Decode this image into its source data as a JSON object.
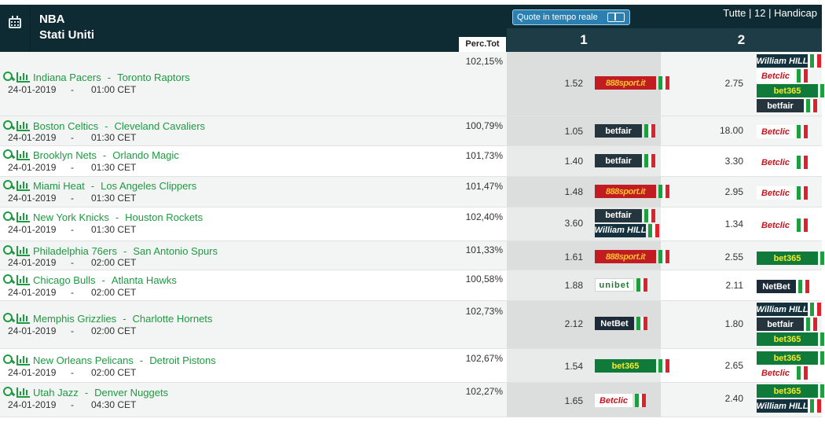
{
  "header": {
    "league": "NBA",
    "country": "Stati Uniti",
    "perc_label": "Perc.Tot",
    "live_label": "Quote in tempo reale",
    "filters": "Tutte | 12 | Handicap",
    "col1": "1",
    "col2": "2",
    "calendar_icon": "calendar-icon"
  },
  "colors": {
    "header_bg": "#0e2b33",
    "accent_green": "#1c9b40",
    "live_button": "#2c7fb1"
  },
  "rows": [
    {
      "home": "Indiana Pacers",
      "away": "Toronto Raptors",
      "date": "24-01-2019",
      "sep": "-",
      "time": "01:00 CET",
      "perc": "102,15%",
      "odd1": "1.52",
      "bk1": [
        "888sport.it"
      ],
      "odd2": "2.75",
      "bk2": [
        "William HILL",
        "Betclic",
        "bet365",
        "betfair"
      ]
    },
    {
      "home": "Boston Celtics",
      "away": "Cleveland Cavaliers",
      "date": "24-01-2019",
      "sep": "-",
      "time": "01:30 CET",
      "perc": "100,79%",
      "odd1": "1.05",
      "bk1": [
        "betfair"
      ],
      "odd2": "18.00",
      "bk2": [
        "Betclic"
      ]
    },
    {
      "home": "Brooklyn Nets",
      "away": "Orlando Magic",
      "date": "24-01-2019",
      "sep": "-",
      "time": "01:30 CET",
      "perc": "101,73%",
      "odd1": "1.40",
      "bk1": [
        "betfair"
      ],
      "odd2": "3.30",
      "bk2": [
        "Betclic"
      ]
    },
    {
      "home": "Miami Heat",
      "away": "Los Angeles Clippers",
      "date": "24-01-2019",
      "sep": "-",
      "time": "01:30 CET",
      "perc": "101,47%",
      "odd1": "1.48",
      "bk1": [
        "888sport.it"
      ],
      "odd2": "2.95",
      "bk2": [
        "Betclic"
      ]
    },
    {
      "home": "New York Knicks",
      "away": "Houston Rockets",
      "date": "24-01-2019",
      "sep": "-",
      "time": "01:30 CET",
      "perc": "102,40%",
      "odd1": "3.60",
      "bk1": [
        "betfair",
        "William HILL"
      ],
      "odd2": "1.34",
      "bk2": [
        "Betclic"
      ]
    },
    {
      "home": "Philadelphia 76ers",
      "away": "San Antonio Spurs",
      "date": "24-01-2019",
      "sep": "-",
      "time": "02:00 CET",
      "perc": "101,33%",
      "odd1": "1.61",
      "bk1": [
        "888sport.it"
      ],
      "odd2": "2.55",
      "bk2": [
        "bet365"
      ]
    },
    {
      "home": "Chicago Bulls",
      "away": "Atlanta Hawks",
      "date": "24-01-2019",
      "sep": "-",
      "time": "02:00 CET",
      "perc": "100,58%",
      "odd1": "1.88",
      "bk1": [
        "unibet"
      ],
      "odd2": "2.11",
      "bk2": [
        "NetBet"
      ]
    },
    {
      "home": "Memphis Grizzlies",
      "away": "Charlotte Hornets",
      "date": "24-01-2019",
      "sep": "-",
      "time": "02:00 CET",
      "perc": "102,73%",
      "odd1": "2.12",
      "bk1": [
        "NetBet"
      ],
      "odd2": "1.80",
      "bk2": [
        "William HILL",
        "betfair",
        "bet365"
      ]
    },
    {
      "home": "New Orleans Pelicans",
      "away": "Detroit Pistons",
      "date": "24-01-2019",
      "sep": "-",
      "time": "02:00 CET",
      "perc": "102,67%",
      "odd1": "1.54",
      "bk1": [
        "bet365"
      ],
      "odd2": "2.65",
      "bk2": [
        "bet365",
        "Betclic"
      ]
    },
    {
      "home": "Utah Jazz",
      "away": "Denver Nuggets",
      "date": "24-01-2019",
      "sep": "-",
      "time": "04:30 CET",
      "perc": "102,27%",
      "odd1": "1.65",
      "bk1": [
        "Betclic"
      ],
      "odd2": "2.40",
      "bk2": [
        "bet365",
        "William HILL"
      ]
    }
  ]
}
